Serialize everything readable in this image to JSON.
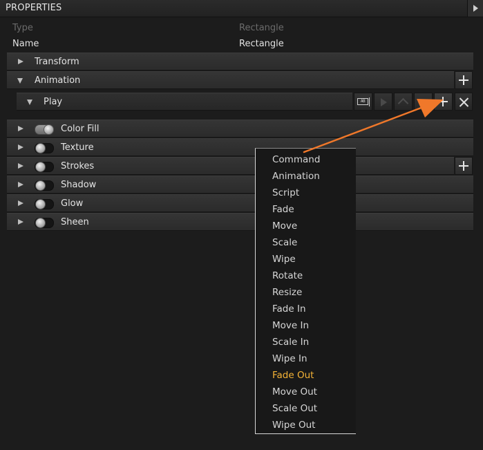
{
  "panel": {
    "title": "PROPERTIES"
  },
  "info": {
    "type_label": "Type",
    "type_value": "Rectangle",
    "name_label": "Name",
    "name_value": "Rectangle"
  },
  "sections": {
    "transform": "Transform",
    "animation": "Animation",
    "play": "Play"
  },
  "effects": [
    {
      "label": "Color Fill",
      "enabled": true
    },
    {
      "label": "Texture",
      "enabled": false
    },
    {
      "label": "Strokes",
      "enabled": false
    },
    {
      "label": "Shadow",
      "enabled": false
    },
    {
      "label": "Glow",
      "enabled": false
    },
    {
      "label": "Sheen",
      "enabled": false
    }
  ],
  "play_toolbar": {
    "rename_glyph": "AB"
  },
  "menu": {
    "items": [
      "Command",
      "Animation",
      "Script",
      "Fade",
      "Move",
      "Scale",
      "Wipe",
      "Rotate",
      "Resize",
      "Fade In",
      "Move In",
      "Scale In",
      "Wipe In",
      "Fade Out",
      "Move Out",
      "Scale Out",
      "Wipe Out"
    ],
    "highlighted_index": 13
  },
  "colors": {
    "highlight": "#f5b336",
    "annotation_arrow": "#f0782a"
  }
}
